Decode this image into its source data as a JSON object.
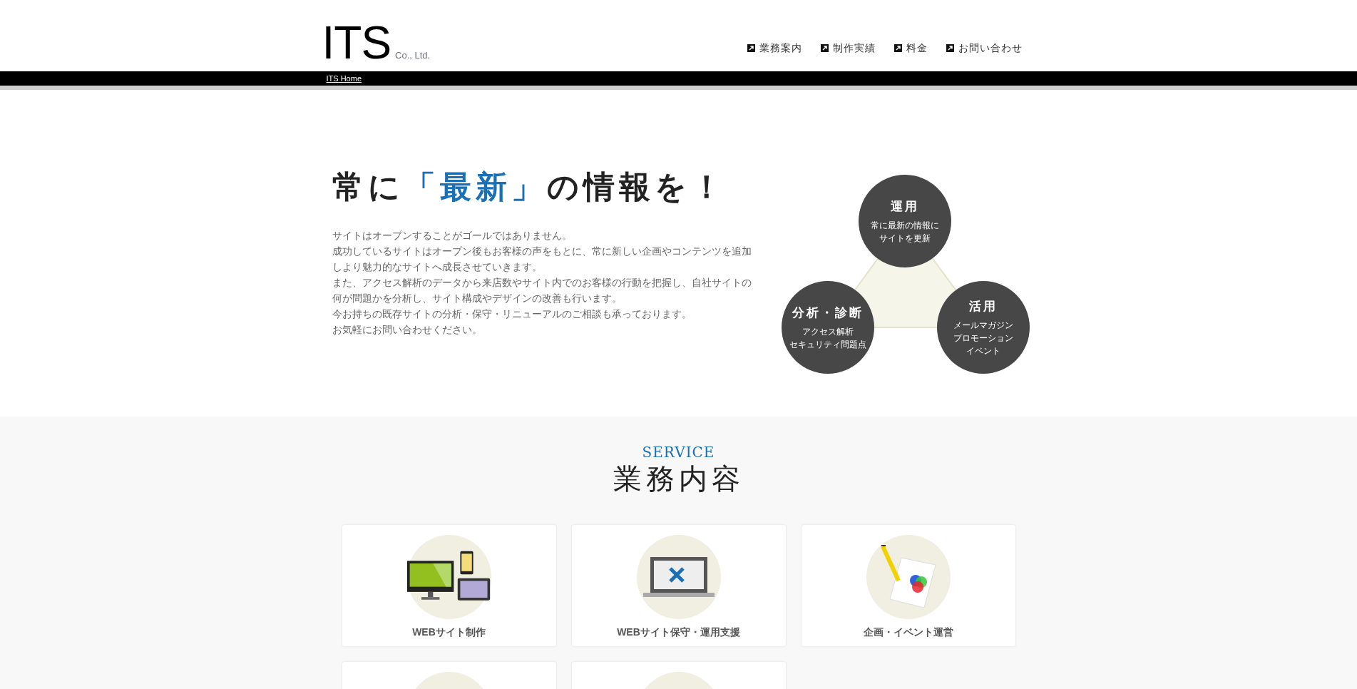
{
  "header": {
    "logo": "ITS",
    "logo_suffix": "Co., Ltd.",
    "nav": [
      {
        "label": "業務案内"
      },
      {
        "label": "制作実績"
      },
      {
        "label": "料金"
      },
      {
        "label": "お問い合わせ"
      }
    ]
  },
  "breadcrumb": "ITS Home",
  "hero": {
    "title_parts": [
      {
        "text": "常に",
        "highlight": false
      },
      {
        "text": "「最新」",
        "highlight": true
      },
      {
        "text": "の情報を！",
        "highlight": false
      }
    ],
    "paragraph_lines": [
      "サイトはオープンすることがゴールではありません。",
      "成功しているサイトはオープン後もお客様の声をもとに、常に新しい企画やコンテンツを追加",
      "しより魅力的なサイトへ成長させていきます。",
      "また、アクセス解析のデータから来店数やサイト内でのお客様の行動を把握し、自社サイトの",
      "何が問題かを分析し、サイト構成やデザインの改善も行います。",
      "今お持ちの既存サイトの分析・保守・リニューアルのご相談も承っております。",
      "お気軽にお問い合わせください。"
    ],
    "diagram": [
      {
        "title": "運用",
        "lines": [
          "常に最新の情報に",
          "サイトを更新"
        ]
      },
      {
        "title": "分析・診断",
        "lines": [
          "アクセス解析",
          "セキュリティ問題点"
        ]
      },
      {
        "title": "活用",
        "lines": [
          "メールマガジン",
          "プロモーション",
          "イベント"
        ]
      }
    ]
  },
  "service": {
    "eyebrow": "SERVICE",
    "heading": "業務内容",
    "cards": [
      {
        "kind": "devices",
        "label": "WEBサイト制作"
      },
      {
        "kind": "laptop",
        "label": "WEBサイト保守・運用支援"
      },
      {
        "kind": "planning",
        "label": "企画・イベント運営"
      },
      {
        "kind": "partial"
      },
      {
        "kind": "partial"
      }
    ]
  }
}
